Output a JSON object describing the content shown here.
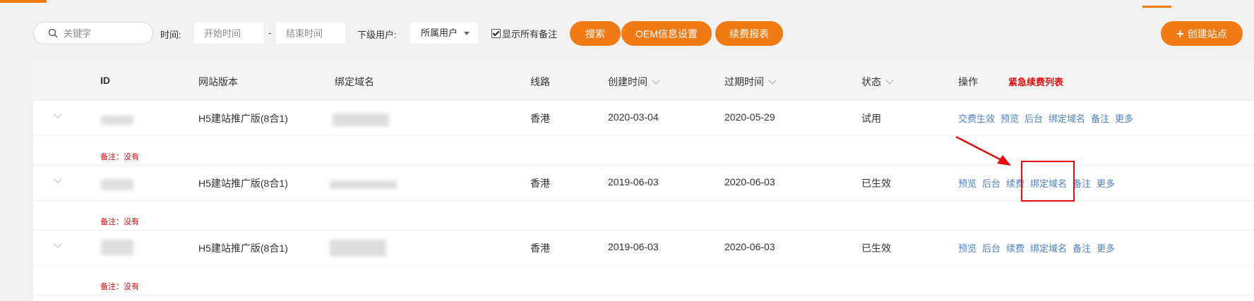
{
  "toolbar": {
    "search_placeholder": "关键字",
    "time_label": "时间:",
    "start_placeholder": "开始时间",
    "dash": "-",
    "end_placeholder": "结束时间",
    "sub_user_label": "下级用户:",
    "sub_user_value": "所属用户",
    "show_notes_label": "显示所有备注",
    "show_notes_checked": true,
    "search_button": "搜索",
    "oem_button": "OEM信息设置",
    "renewal_report_button": "续费报表",
    "create_site_button": "创建站点",
    "create_site_icon": "plus-icon"
  },
  "table": {
    "headers": {
      "id": "ID",
      "version": "网站版本",
      "domain": "绑定域名",
      "line": "线路",
      "created": "创建时间",
      "expires": "过期时间",
      "status": "状态",
      "actions": "操作",
      "urgent": "紧急续费列表"
    },
    "rows": [
      {
        "version": "H5建站推广版(8合1)",
        "line": "香港",
        "created": "2020-03-04",
        "expires": "2020-05-29",
        "status": "试用",
        "actions": [
          "交费生效",
          "预览",
          "后台",
          "绑定域名",
          "备注",
          "更多"
        ],
        "remark": "备注：没有"
      },
      {
        "version": "H5建站推广版(8合1)",
        "line": "香港",
        "created": "2019-06-03",
        "expires": "2020-06-03",
        "status": "已生效",
        "actions": [
          "预览",
          "后台",
          "续费",
          "绑定域名",
          "备注",
          "更多"
        ],
        "remark": "备注：没有"
      },
      {
        "version": "H5建站推广版(8合1)",
        "line": "香港",
        "created": "2019-06-03",
        "expires": "2020-06-03",
        "status": "已生效",
        "actions": [
          "预览",
          "后台",
          "续费",
          "绑定域名",
          "备注",
          "更多"
        ],
        "remark": "备注：没有"
      }
    ]
  },
  "colors": {
    "accent": "#f07a14",
    "link": "#4e7fc4",
    "alert": "#e30b0b"
  }
}
